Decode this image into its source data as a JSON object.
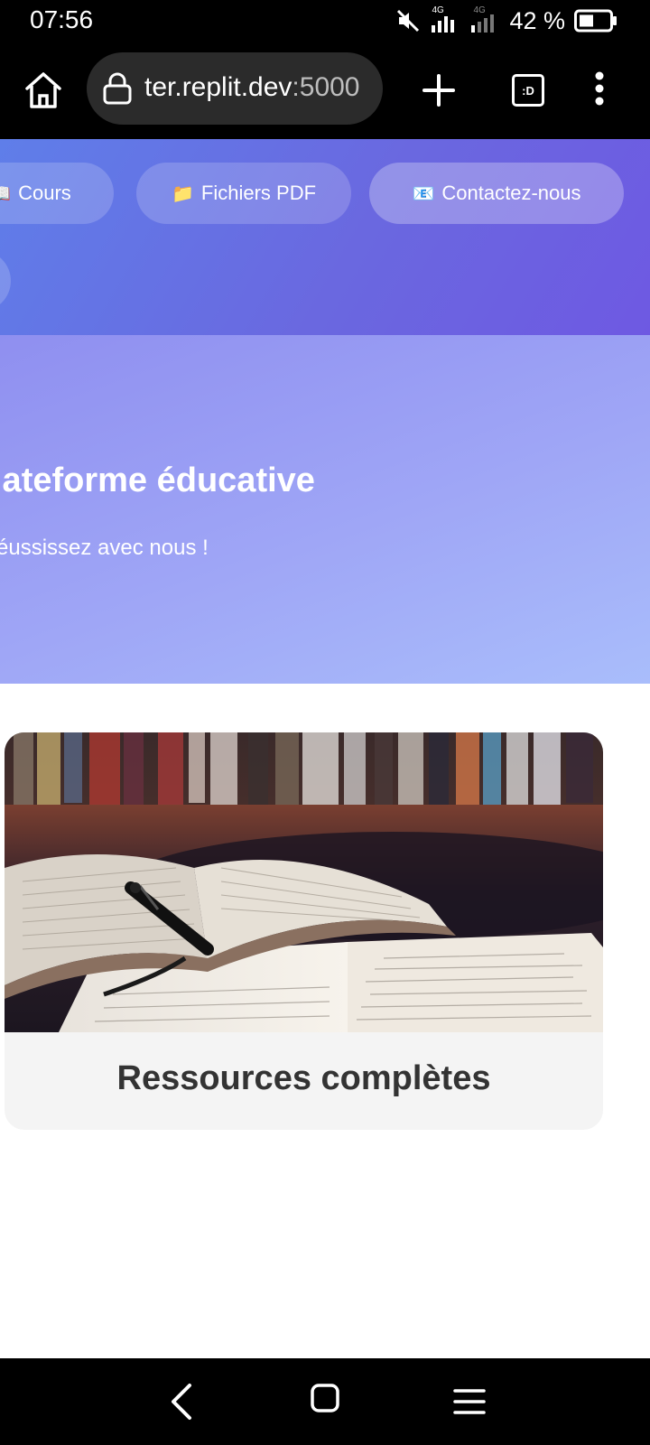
{
  "status_bar": {
    "time": "07:56",
    "network_small_1": "4G",
    "network_small_2": "4G",
    "battery_percent": "42 %",
    "icons": [
      "mute-icon",
      "signal-icon",
      "signal-icon",
      "battery-icon"
    ]
  },
  "browser": {
    "url_host": "ter.replit.dev",
    "url_port": ":5000",
    "tabs_count_label": ":D",
    "icons": [
      "home-icon",
      "lock-icon",
      "plus-icon",
      "tabs-icon",
      "more-vert-icon"
    ]
  },
  "nav": {
    "items": [
      {
        "emoji": "📖",
        "label": "Cours"
      },
      {
        "emoji": "📁",
        "label": "Fichiers PDF"
      },
      {
        "emoji": "📧",
        "label": "Contactez-nous"
      }
    ]
  },
  "hero": {
    "title": "lateforme éducative",
    "subtitle": "éussissez avec nous !"
  },
  "card": {
    "title": "Ressources complètes"
  },
  "colors": {
    "nav_gradient_start": "#5f7ee9",
    "nav_gradient_end": "#6e59e2",
    "hero_gradient_start": "#8f8ff0",
    "hero_gradient_end": "#a9bdfb",
    "card_background": "#f4f4f4",
    "card_title": "#333333"
  }
}
